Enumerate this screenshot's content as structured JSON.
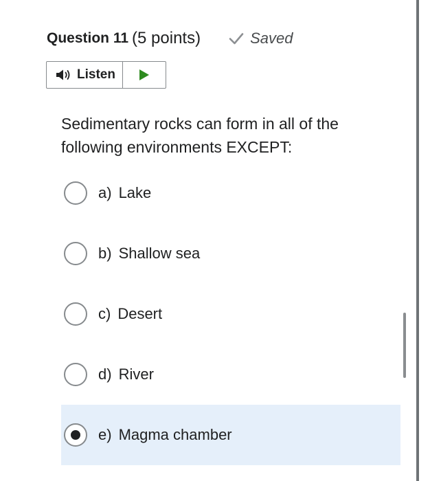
{
  "question": {
    "title": "Question 11",
    "points": "(5 points)",
    "saved_label": "Saved"
  },
  "listen": {
    "label": "Listen"
  },
  "prompt": "Sedimentary rocks can form in all of the following environments EXCEPT:",
  "options": [
    {
      "letter": "a)",
      "text": "Lake",
      "selected": false
    },
    {
      "letter": "b)",
      "text": "Shallow sea",
      "selected": false
    },
    {
      "letter": "c)",
      "text": "Desert",
      "selected": false
    },
    {
      "letter": "d)",
      "text": "River",
      "selected": false
    },
    {
      "letter": "e)",
      "text": "Magma chamber",
      "selected": true
    }
  ],
  "colors": {
    "play_green": "#2e8b1f",
    "selected_bg": "#e5effa",
    "check_gray": "#8c8f92"
  },
  "icons": {
    "saved": "check-icon",
    "listen": "speaker-icon",
    "play": "play-icon"
  }
}
